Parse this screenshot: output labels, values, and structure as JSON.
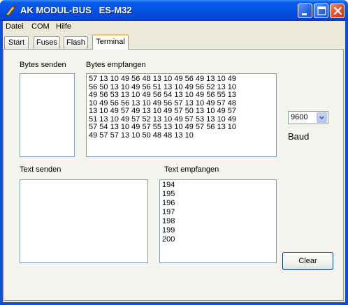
{
  "window": {
    "title": "AK MODUL-BUS   ES-M32"
  },
  "menu": {
    "items": [
      "Datei",
      "COM",
      "Hilfe"
    ]
  },
  "tabs": [
    {
      "label": "Start"
    },
    {
      "label": "Fuses"
    },
    {
      "label": "Flash"
    },
    {
      "label": "Terminal"
    }
  ],
  "terminal": {
    "bytes_send_label": "Bytes senden",
    "bytes_recv_label": "Bytes empfangen",
    "bytes_recv_text": "57 13 10 49 56 48 13 10 49 56 49 13 10 49\n56 50 13 10 49 56 51 13 10 49 56 52 13 10\n49 56 53 13 10 49 56 54 13 10 49 56 55 13\n10 49 56 56 13 10 49 56 57 13 10 49 57 48\n13 10 49 57 49 13 10 49 57 50 13 10 49 57\n51 13 10 49 57 52 13 10 49 57 53 13 10 49\n57 54 13 10 49 57 55 13 10 49 57 56 13 10\n49 57 57 13 10 50 48 48 13 10",
    "text_send_label": "Text senden",
    "text_recv_label": "Text empfangen",
    "text_recv_lines": [
      "194",
      "195",
      "196",
      "197",
      "198",
      "199",
      "200"
    ],
    "baud_value": "9600",
    "baud_label": "Baud",
    "clear_label": "Clear"
  },
  "colors": {
    "titlebar": "#0551e4",
    "face": "#ece9d8",
    "tab_highlight": "#ffc83c"
  }
}
